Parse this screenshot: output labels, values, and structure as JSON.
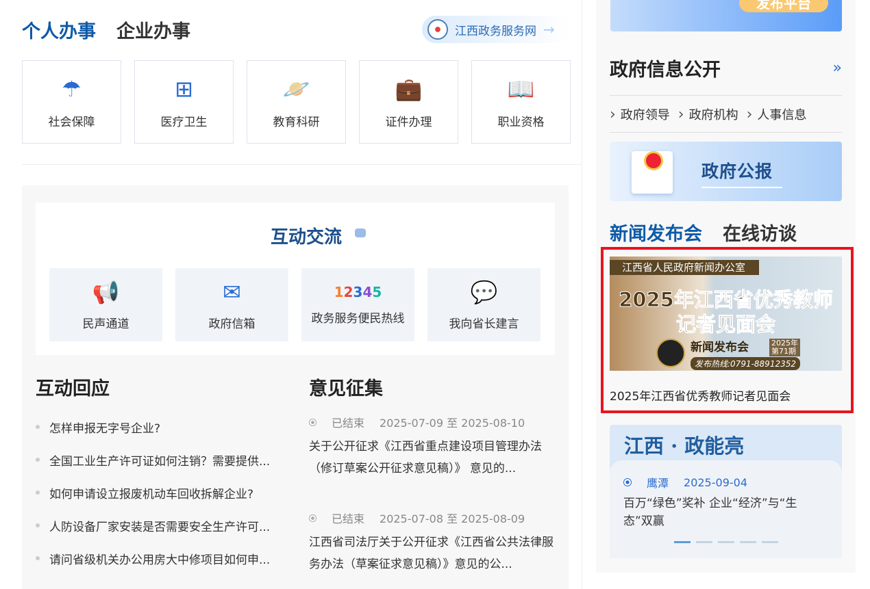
{
  "tabs": {
    "personal": "个人办事",
    "enterprise": "企业办事"
  },
  "portal_link": "江西政务服务网",
  "services": [
    {
      "label": "社会保障",
      "icon": "umbrella-icon"
    },
    {
      "label": "医疗卫生",
      "icon": "medical-kit-icon"
    },
    {
      "label": "教育科研",
      "icon": "planet-icon"
    },
    {
      "label": "证件办理",
      "icon": "briefcase-icon"
    },
    {
      "label": "职业资格",
      "icon": "book-icon"
    }
  ],
  "interaction": {
    "title": "互动交流",
    "buttons": [
      {
        "label": "民声通道",
        "icon": "megaphone-icon"
      },
      {
        "label": "政府信箱",
        "icon": "mail-icon"
      },
      {
        "label": "政务服务便民热线",
        "icon": "hotline-12345-icon",
        "number": [
          "1",
          "2",
          "3",
          "4",
          "5"
        ]
      },
      {
        "label": "我向省长建言",
        "icon": "chat-icon"
      }
    ]
  },
  "responses": {
    "title": "互动回应",
    "items": [
      "怎样申报无字号企业?",
      "全国工业生产许可证如何注销？需要提供...",
      "如何申请设立报废机动车回收拆解企业?",
      "人防设备厂家安装是否需要安全生产许可...",
      "请问省级机关办公用房大中修项目如何申..."
    ]
  },
  "opinions": {
    "title": "意见征集",
    "items": [
      {
        "status": "已结束",
        "dates": "2025-07-09 至 2025-08-10",
        "title": "关于公开征求《江西省重点建设项目管理办法（修订草案公开征求意见稿）》 意见的..."
      },
      {
        "status": "已结束",
        "dates": "2025-07-08 至 2025-08-09",
        "title": "江西省司法厅关于公开征求《江西省公共法律服务办法（草案征求意见稿）》意见的公..."
      }
    ]
  },
  "top_banner": {
    "label": "发布平台"
  },
  "gov_info": {
    "title": "政府信息公开",
    "more": "»",
    "links": [
      "政府领导",
      "政府机构",
      "人事信息"
    ]
  },
  "gazette": {
    "title": "政府公报"
  },
  "news": {
    "tabs": [
      "新闻发布会",
      "在线访谈"
    ],
    "image": {
      "org": "江西省人民政府新闻办公室",
      "line1": "2025年江西省优秀教师",
      "line2": "记者见面会",
      "brand": "新闻发布会",
      "year": "2025年",
      "issue": "第71期",
      "hotline": "发布热线:0791-88912352"
    },
    "caption": "2025年江西省优秀教师记者见面会"
  },
  "zhengnengliang": {
    "title": "江西 · 政能亮",
    "city": "鹰潭",
    "date": "2025-09-04",
    "text": "百万“绿色”奖补 企业“经济”与“生态”双赢",
    "slides": 5,
    "active_slide": 1
  },
  "colors": {
    "accent": "#0d5aa7",
    "highlight": "#e8141e"
  }
}
